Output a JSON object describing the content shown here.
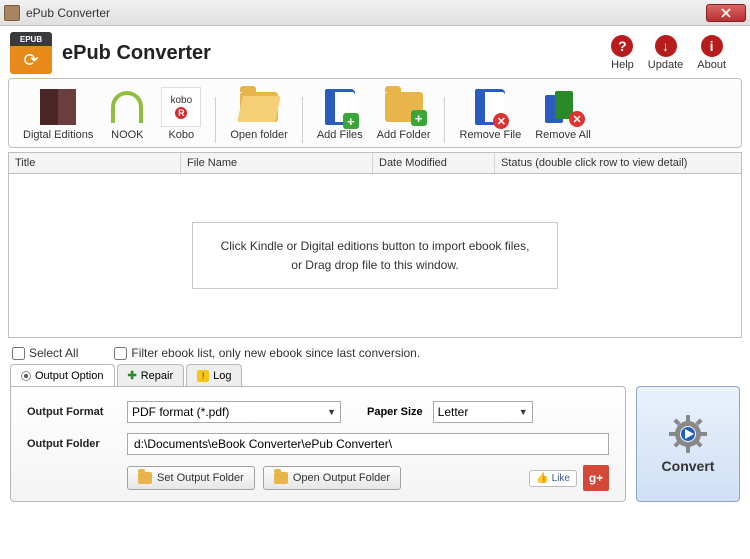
{
  "window": {
    "title": "ePub Converter"
  },
  "app": {
    "title": "ePub Converter",
    "logo_tag": "EPUB"
  },
  "header_links": {
    "help": "Help",
    "update": "Update",
    "about": "About"
  },
  "toolbar": {
    "digital_editions": "Digtal Editions",
    "nook": "NOOK",
    "kobo": "Kobo",
    "kobo_tag": "kobo",
    "open_folder": "Open folder",
    "add_files": "Add Files",
    "add_folder": "Add Folder",
    "remove_file": "Remove File",
    "remove_all": "Remove All"
  },
  "columns": {
    "title": "Title",
    "filename": "File Name",
    "modified": "Date Modified",
    "status": "Status (double click row to view detail)"
  },
  "hint": {
    "line1": "Click Kindle or Digital editions button to import ebook files,",
    "line2": "or Drag drop file to this window."
  },
  "checks": {
    "select_all": "Select All",
    "filter": "Filter ebook list, only new ebook since last conversion."
  },
  "tabs": {
    "output": "Output Option",
    "repair": "Repair",
    "log": "Log"
  },
  "output": {
    "format_label": "Output Format",
    "format_value": "PDF format (*.pdf)",
    "paper_label": "Paper Size",
    "paper_value": "Letter",
    "folder_label": "Output Folder",
    "folder_value": "d:\\Documents\\eBook Converter\\ePub Converter\\",
    "set_folder": "Set Output Folder",
    "open_folder": "Open Output Folder",
    "like": "Like",
    "gplus": "g+"
  },
  "convert": {
    "label": "Convert"
  }
}
